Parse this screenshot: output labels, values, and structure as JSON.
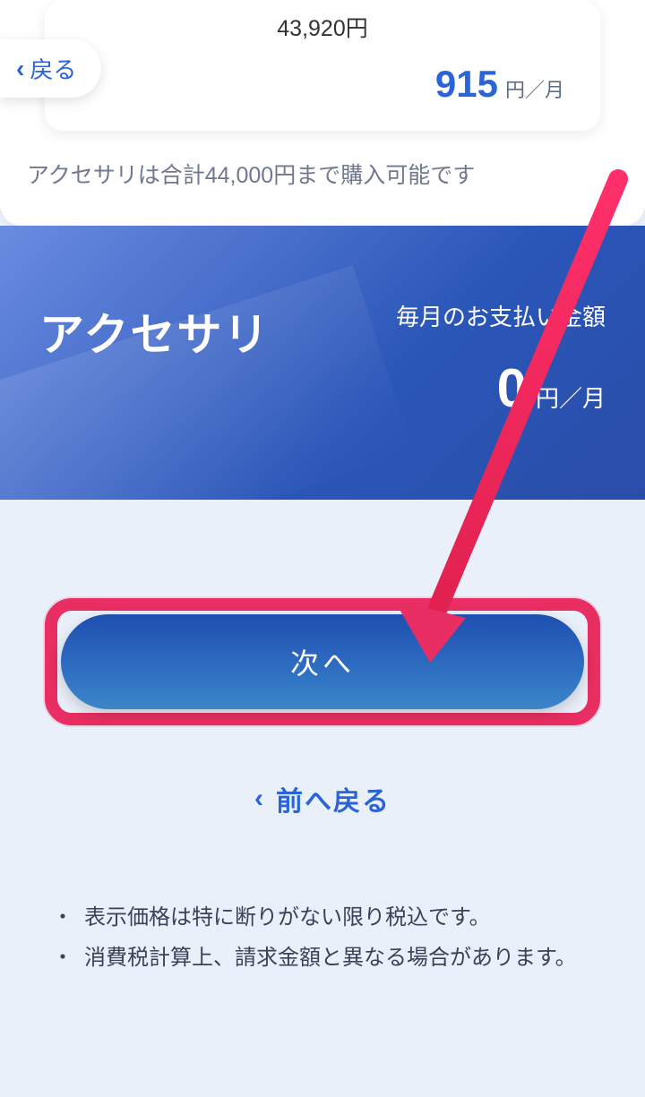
{
  "back_pill": {
    "label": "戻る"
  },
  "price_card": {
    "total": "43,920円",
    "monthly_value": "915",
    "monthly_unit": "円／月"
  },
  "limit_note": "アクセサリは合計44,000円まで購入可能です",
  "summary": {
    "title": "アクセサリ",
    "label": "毎月のお支払い金額",
    "amount": "0",
    "unit": "円／月"
  },
  "actions": {
    "next": "次へ",
    "prev": "前へ戻る"
  },
  "notes": [
    "表示価格は特に断りがない限り税込です。",
    "消費税計算上、請求金額と異なる場合があります。"
  ],
  "colors": {
    "accent": "#2a64d6",
    "highlight": "#e82e63"
  }
}
